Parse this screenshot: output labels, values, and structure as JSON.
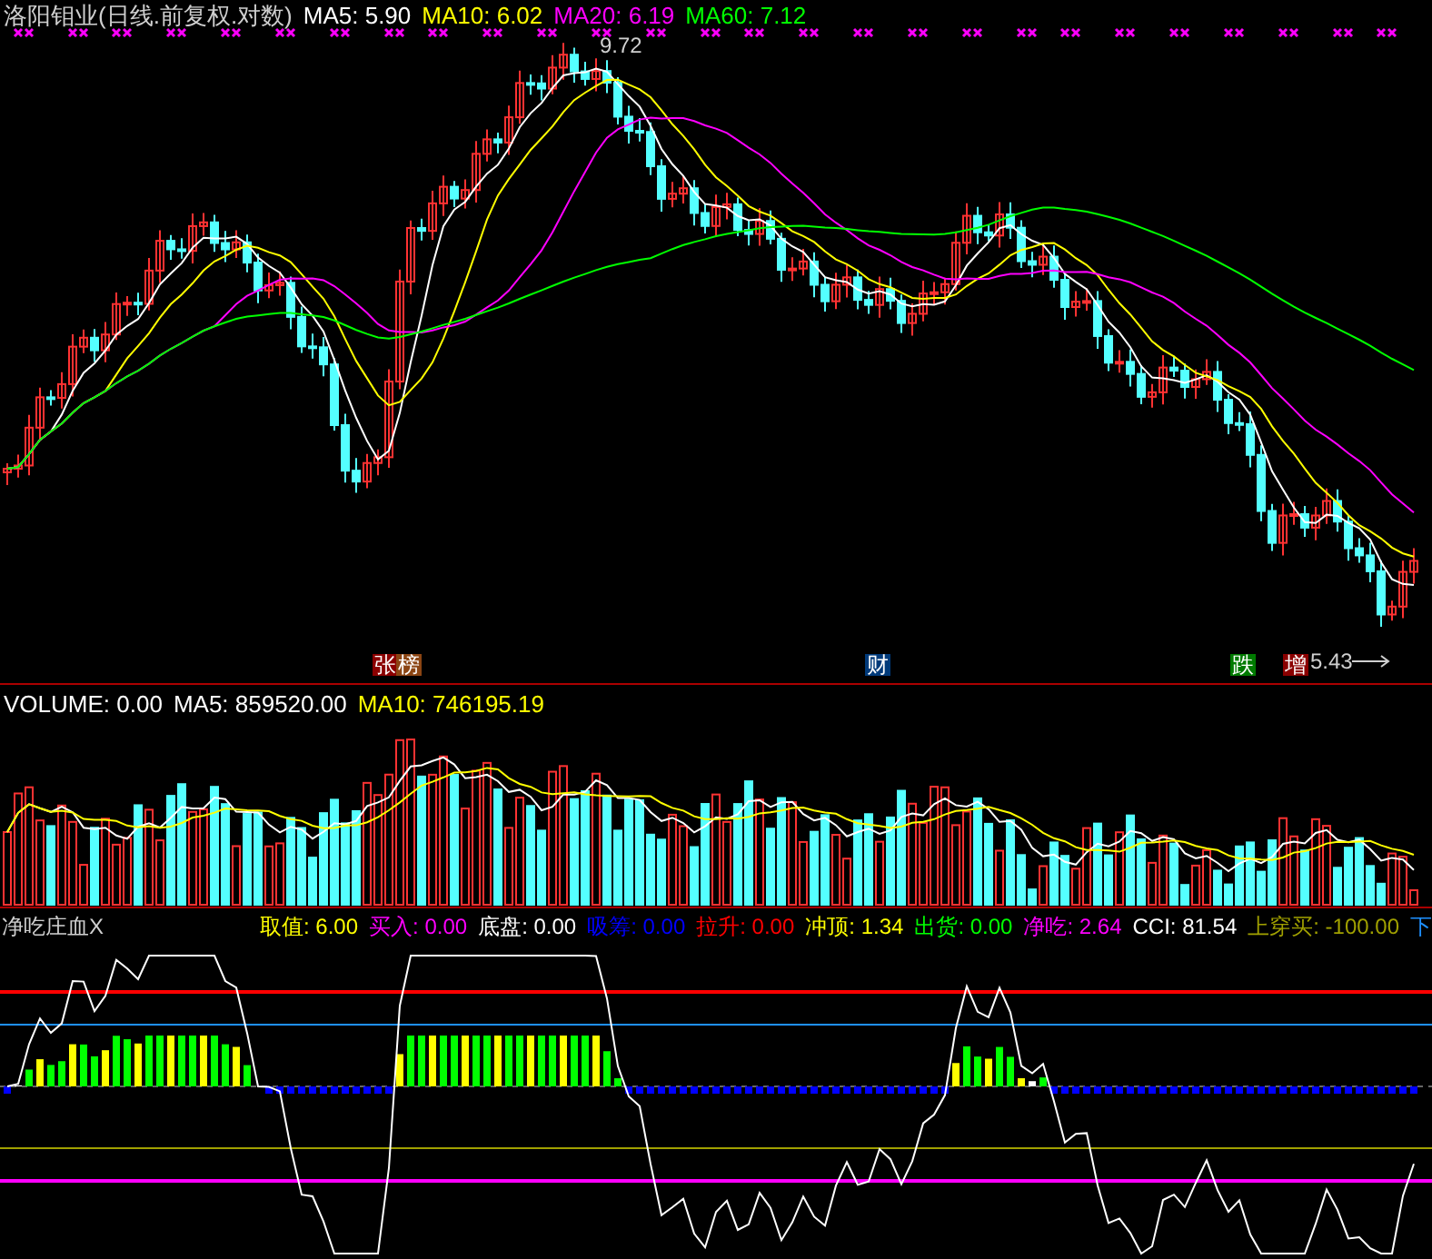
{
  "stock_header": {
    "title": "洛阳钼业(日线.前复权.对数)",
    "ma": [
      {
        "label": "MA5: 5.90",
        "color": "#ffffff"
      },
      {
        "label": "MA10: 6.02",
        "color": "#ffff00"
      },
      {
        "label": "MA20: 6.19",
        "color": "#ff00ff"
      },
      {
        "label": "MA60: 7.12",
        "color": "#00ff00"
      }
    ]
  },
  "price_labels": [
    {
      "kind": "high",
      "text": "9.72"
    },
    {
      "kind": "low",
      "text": "5.43"
    }
  ],
  "event_tags": [
    {
      "text": "张",
      "color": "#8b0000"
    },
    {
      "text": "榜",
      "color": "#8b4513"
    },
    {
      "text": "财",
      "color": "#003a7a"
    },
    {
      "text": "跌",
      "color": "#007a00"
    },
    {
      "text": "增",
      "color": "#8b0000"
    }
  ],
  "volume_header": {
    "items": [
      {
        "label": "VOLUME: 0.00",
        "color": "#ffffff"
      },
      {
        "label": "MA5: 859520.00",
        "color": "#ffffff"
      },
      {
        "label": "MA10: 746195.19",
        "color": "#ffff00"
      }
    ]
  },
  "indicator_header": {
    "title": "净吃庄血X",
    "items": [
      {
        "label": "取值: 6.00",
        "color": "#ffff00"
      },
      {
        "label": "买入: 0.00",
        "color": "#ff00ff"
      },
      {
        "label": "底盘: 0.00",
        "color": "#ffffff"
      },
      {
        "label": "吸筹: 0.00",
        "color": "#0000ff"
      },
      {
        "label": "拉升: 0.00",
        "color": "#ff0000"
      },
      {
        "label": "冲顶: 1.34",
        "color": "#ffff00"
      },
      {
        "label": "出货: 0.00",
        "color": "#00ff00"
      },
      {
        "label": "净吃: 2.64",
        "color": "#ff00ff"
      },
      {
        "label": "CCI: 81.54",
        "color": "#ffffff"
      },
      {
        "label": "上穿买: -100.00",
        "color": "#a0a000"
      },
      {
        "label": "下",
        "color": "#1e90ff"
      }
    ]
  }
}
